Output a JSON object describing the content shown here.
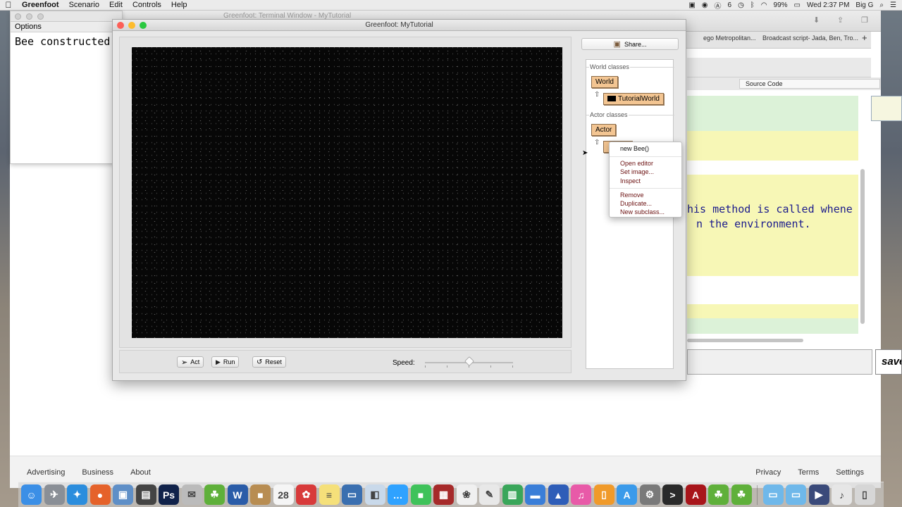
{
  "menubar": {
    "apple": "",
    "items": [
      "Greenfoot",
      "Scenario",
      "Edit",
      "Controls",
      "Help"
    ],
    "battery": "99%",
    "clock": "Wed 2:37 PM",
    "user": "Big G",
    "tray_count": "6"
  },
  "terminal": {
    "title": "Greenfoot: Terminal Window - MyTutorial",
    "options_label": "Options",
    "output": "Bee constructed"
  },
  "browser": {
    "tabs": [
      "ego Metropolitan...",
      "Broadcast script- Jada, Ben, Tro..."
    ],
    "source_tab": "Source Code",
    "code_lines": [
      "his method is called whene",
      "n the environment."
    ],
    "save_label": "save",
    "footer_left": [
      "Advertising",
      "Business",
      "About"
    ],
    "footer_right": [
      "Privacy",
      "Terms",
      "Settings"
    ]
  },
  "greenfoot": {
    "title": "Greenfoot: MyTutorial",
    "share_label": "Share...",
    "world_classes_label": "World classes",
    "world_class": "World",
    "world_subclass": "TutorialWorld",
    "actor_classes_label": "Actor classes",
    "actor_class": "Actor",
    "act_label": "Act",
    "run_label": "Run",
    "reset_label": "Reset",
    "speed_label": "Speed:",
    "speed_fraction": 0.5
  },
  "context_menu": {
    "items": [
      "new Bee()",
      "Open editor",
      "Set image...",
      "Inspect",
      "Remove",
      "Duplicate...",
      "New subclass..."
    ]
  },
  "dock": {
    "icons": [
      {
        "name": "finder-icon",
        "color": "#3b8fe6",
        "glyph": "☺"
      },
      {
        "name": "launchpad-icon",
        "color": "#8a8f96",
        "glyph": "✈"
      },
      {
        "name": "safari-icon",
        "color": "#2b8ddd",
        "glyph": "✦"
      },
      {
        "name": "firefox-icon",
        "color": "#e5622a",
        "glyph": "●"
      },
      {
        "name": "preview-icon",
        "color": "#5f8fc7",
        "glyph": "▣"
      },
      {
        "name": "final-cut-icon",
        "color": "#444444",
        "glyph": "▤"
      },
      {
        "name": "photoshop-icon",
        "color": "#10224a",
        "glyph": "Ps"
      },
      {
        "name": "mail-bird-icon",
        "color": "#bbbbbb",
        "glyph": "✉"
      },
      {
        "name": "greenfoot-icon",
        "color": "#5fb03a",
        "glyph": "☘"
      },
      {
        "name": "word-icon",
        "color": "#2a5ca8",
        "glyph": "W"
      },
      {
        "name": "box-icon",
        "color": "#b88d52",
        "glyph": "■"
      },
      {
        "name": "calendar-icon",
        "color": "#f5f5f5",
        "glyph": "28"
      },
      {
        "name": "lifesaver-icon",
        "color": "#d83a3a",
        "glyph": "✿"
      },
      {
        "name": "notes-icon",
        "color": "#f5e07a",
        "glyph": "≡"
      },
      {
        "name": "desktop-icon",
        "color": "#3a6fb0",
        "glyph": "▭"
      },
      {
        "name": "preview2-icon",
        "color": "#c9d9ea",
        "glyph": "◧"
      },
      {
        "name": "messages-icon",
        "color": "#2fa2ff",
        "glyph": "…"
      },
      {
        "name": "facetime-icon",
        "color": "#3fc25a",
        "glyph": "■"
      },
      {
        "name": "photo-booth-icon",
        "color": "#a62a2a",
        "glyph": "▦"
      },
      {
        "name": "photos-icon",
        "color": "#f0f0f0",
        "glyph": "❀"
      },
      {
        "name": "textedit-icon",
        "color": "#e8e8e8",
        "glyph": "✎"
      },
      {
        "name": "numbers-icon",
        "color": "#3aa65a",
        "glyph": "▥"
      },
      {
        "name": "keynote-icon",
        "color": "#3a7ed8",
        "glyph": "▬"
      },
      {
        "name": "vlc-icon",
        "color": "#2e5db8",
        "glyph": "▲"
      },
      {
        "name": "itunes-icon",
        "color": "#e85aa8",
        "glyph": "♫"
      },
      {
        "name": "ibooks-icon",
        "color": "#f09a2a",
        "glyph": "▯"
      },
      {
        "name": "app-store-icon",
        "color": "#3a9aea",
        "glyph": "A"
      },
      {
        "name": "system-preferences-icon",
        "color": "#7a7a7a",
        "glyph": "⚙"
      },
      {
        "name": "terminal-icon",
        "color": "#2a2a2a",
        "glyph": ">"
      },
      {
        "name": "acrobat-icon",
        "color": "#a8151a",
        "glyph": "A"
      },
      {
        "name": "greenfoot2-icon",
        "color": "#5fb03a",
        "glyph": "☘"
      },
      {
        "name": "greenfoot3-icon",
        "color": "#5fb03a",
        "glyph": "☘"
      }
    ],
    "right_icons": [
      {
        "name": "folder-icon",
        "color": "#6fb8ea",
        "glyph": "▭"
      },
      {
        "name": "folder2-icon",
        "color": "#6fb8ea",
        "glyph": "▭"
      },
      {
        "name": "movies-folder-icon",
        "color": "#3a4a7a",
        "glyph": "▶"
      },
      {
        "name": "documents-icon",
        "color": "#e6e6e6",
        "glyph": "♪"
      },
      {
        "name": "trash-icon",
        "color": "#d6d6d6",
        "glyph": "▯"
      }
    ]
  }
}
